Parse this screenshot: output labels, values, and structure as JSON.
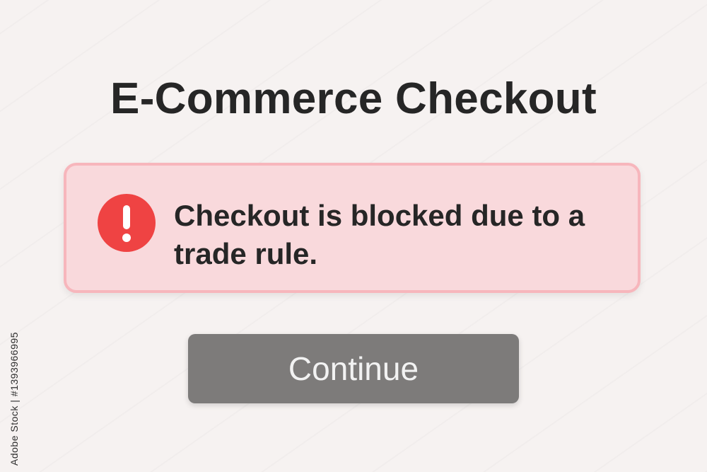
{
  "page": {
    "title": "E-Commerce Checkout",
    "background_color": "#f6f2f1"
  },
  "alert": {
    "icon": "exclamation-circle-icon",
    "message": "Checkout is blocked due to a trade rule.",
    "icon_color": "#ef4343",
    "background_color": "#f9d9dc",
    "border_color": "#f7b6bc"
  },
  "continue_button": {
    "label": "Continue",
    "state": "disabled",
    "color": "#7d7b7a"
  },
  "watermark": {
    "side_text": "Adobe Stock | #1393966995",
    "pattern_text": "Adobe Stock"
  }
}
